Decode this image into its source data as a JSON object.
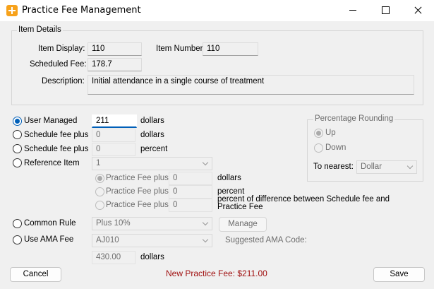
{
  "window": {
    "title": "Practice Fee Management",
    "icon": "plus-app-icon"
  },
  "item_details": {
    "legend": "Item Details",
    "item_display_label": "Item Display:",
    "item_display_value": "110",
    "item_number_label": "Item Number:",
    "item_number_value": "110",
    "scheduled_fee_label": "Scheduled Fee:",
    "scheduled_fee_value": "178.7",
    "description_label": "Description:",
    "description_value": "Initial attendance in a single course of treatment"
  },
  "options": {
    "user_managed": {
      "label": "User Managed",
      "value": "211",
      "unit": "dollars",
      "selected": true
    },
    "schedule_fee_plus_dollars": {
      "label": "Schedule fee plus",
      "value": "0",
      "unit": "dollars"
    },
    "schedule_fee_plus_percent": {
      "label": "Schedule fee plus",
      "value": "0",
      "unit": "percent"
    },
    "reference_item": {
      "label": "Reference Item",
      "selected_value": "1",
      "sub": [
        {
          "label": "Practice Fee plus",
          "value": "0",
          "unit": "dollars",
          "selected": true
        },
        {
          "label": "Practice Fee plus",
          "value": "0",
          "unit": "percent",
          "selected": false
        },
        {
          "label": "Practice Fee plus",
          "value": "0",
          "unit": "percent of difference between Schedule fee and Practice Fee",
          "selected": false
        }
      ]
    },
    "common_rule": {
      "label": "Common Rule",
      "selected_value": "Plus 10%",
      "button": "Manage"
    },
    "ama_fee": {
      "label": "Use AMA Fee",
      "selected_value": "AJ010",
      "suggested_label": "Suggested AMA Code:",
      "value": "430.00",
      "unit": "dollars"
    }
  },
  "rounding": {
    "legend": "Percentage Rounding",
    "up": "Up",
    "down": "Down",
    "nearest_label": "To nearest:",
    "nearest_value": "Dollar",
    "selected": "Up"
  },
  "footer": {
    "cancel": "Cancel",
    "new_fee": "New Practice Fee: $211.00",
    "save": "Save"
  },
  "colors": {
    "accent": "#005fb8",
    "fee_text": "#a01010",
    "app_icon": "#f7a21b"
  }
}
